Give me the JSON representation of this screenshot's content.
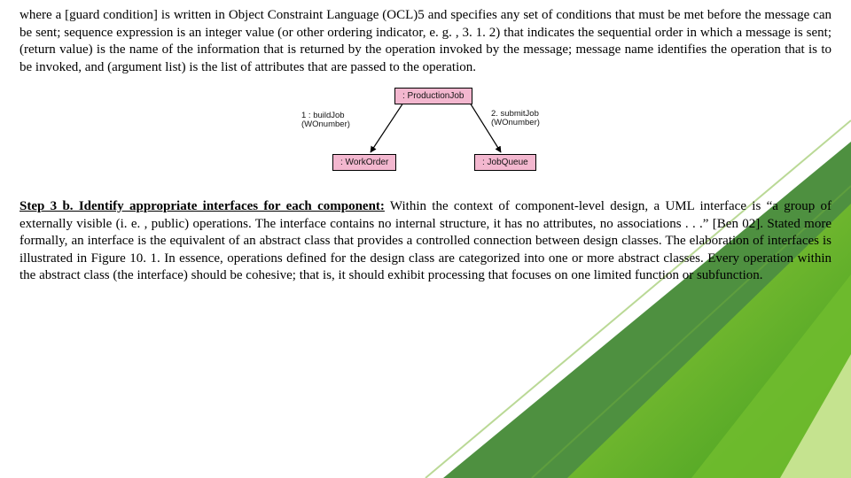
{
  "paragraph1": {
    "text": "where a [guard condition] is written in Object Constraint Language (OCL)5 and specifies any set of conditions that must be met before the message can be sent; sequence expression is an integer value (or other ordering indicator, e. g. , 3. 1. 2) that indicates the sequential order in which a message is sent; (return value) is the name of the information that is returned by the operation invoked by the message; message name identifies the operation that is to be invoked, and (argument list) is the list of attributes that are passed to the operation."
  },
  "diagram": {
    "box_top": ": ProductionJob",
    "box_left": ": WorkOrder",
    "box_right": ": JobQueue",
    "msg1_line1": "1 : buildJob",
    "msg1_line2": "(WOnumber)",
    "msg2_line1": "2. submitJob",
    "msg2_line2": "(WOnumber)"
  },
  "paragraph2": {
    "step_label": "Step 3 b. Identify appropriate interfaces for each component:",
    "rest": " Within the context of component-level design, a UML interface is “a group of externally visible (i. e. , public) operations. The interface contains no internal structure, it has no attributes, no associations . . .” [Ben 02]. Stated more formally, an interface is the equivalent of an abstract class that provides a controlled connection between design classes. The elaboration of interfaces is illustrated in Figure 10. 1. In essence, operations defined for the design class are categorized into one or more abstract classes. Every operation within the abstract class (the interface) should be cohesive; that is, it should exhibit processing that focuses on one limited function or subfunction."
  }
}
